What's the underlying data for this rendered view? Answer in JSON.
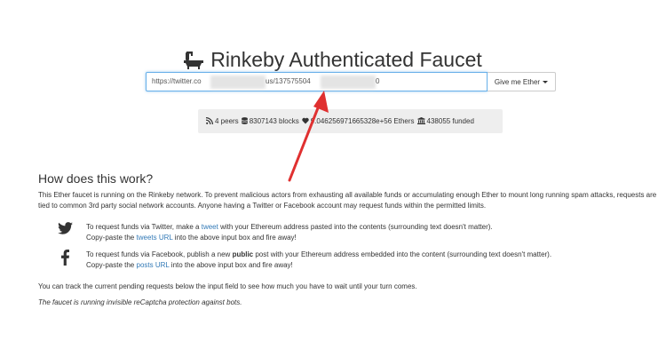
{
  "header": {
    "title": "Rinkeby Authenticated Faucet",
    "icon": "bath-icon"
  },
  "form": {
    "url_value_start": "https://twitter.co",
    "url_value_mid1": "us/137575504",
    "url_value_end": "0",
    "button_label": "Give me Ether",
    "accent_color": "#66afe9"
  },
  "stats": {
    "peers": "4 peers",
    "blocks": "8307143 blocks",
    "ethers": "9.046256971665328e+56 Ethers",
    "funded": "438055 funded"
  },
  "info": {
    "heading": "How does this work?",
    "intro": "This Ether faucet is running on the Rinkeby network. To prevent malicious actors from exhausting all available funds or accumulating enough Ether to mount long running spam attacks, requests are tied to common 3rd party social network accounts. Anyone having a Twitter or Facebook account may request funds within the permitted limits.",
    "twitter": {
      "l1_a": "To request funds via Twitter, make a",
      "l1_link": "tweet",
      "l1_b": "with your Ethereum address pasted into the contents (surrounding text doesn't matter).",
      "l2_a": "Copy-paste the",
      "l2_link": "tweets URL",
      "l2_b": "into the above input box and fire away!"
    },
    "facebook": {
      "l1_a": "To request funds via Facebook, publish a new",
      "l1_bold": "public",
      "l1_b": "post with your Ethereum address embedded into the content (surrounding text doesn't matter).",
      "l2_a": "Copy-paste the",
      "l2_link": "posts URL",
      "l2_b": "into the above input box and fire away!"
    },
    "track": "You can track the current pending requests below the input field to see how much you have to wait until your turn comes.",
    "captcha": "The faucet is running invisible reCaptcha protection against bots."
  },
  "annotation": {
    "arrow_color": "#e03030"
  }
}
